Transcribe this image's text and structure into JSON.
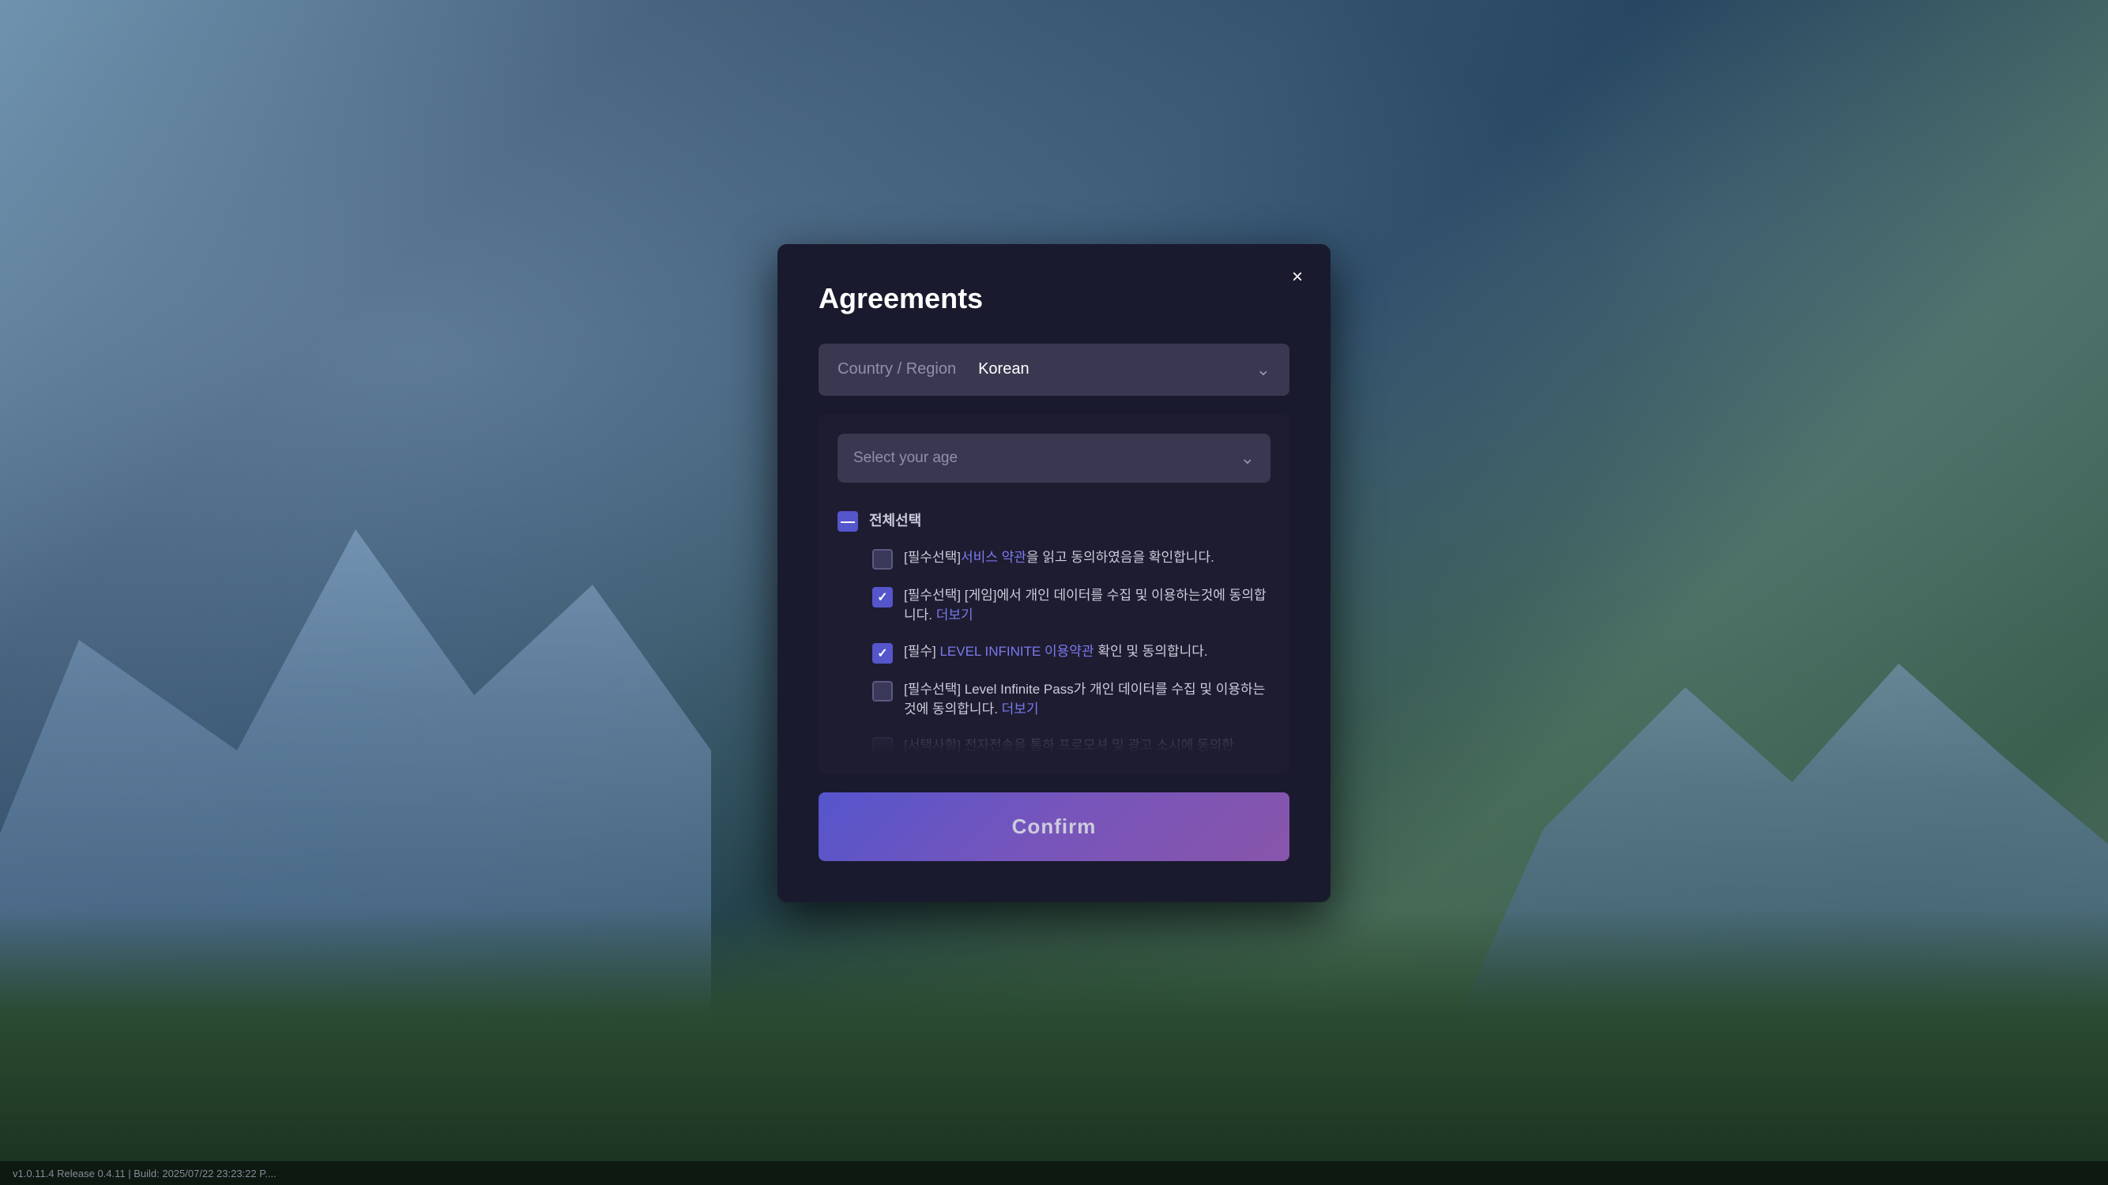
{
  "background": {
    "description": "Mountain landscape with forest"
  },
  "dialog": {
    "title": "Agreements",
    "close_label": "×",
    "country_region_label": "Country / Region",
    "country_region_value": "Korean",
    "age_placeholder": "Select your age",
    "select_all_label": "전체선택",
    "agreements": [
      {
        "id": "item1",
        "state": "unchecked",
        "text_before": "[필수선택]",
        "link_text": "서비스 약관",
        "text_after": "을 읽고 동의하였음을 확인합니다."
      },
      {
        "id": "item2",
        "state": "checked",
        "text": "[필수선택] [게임]에서 개인 데이터를 수집 및 이용하는것에 동의합니다.",
        "link_text": "더보기"
      },
      {
        "id": "item3",
        "state": "checked",
        "text_before": "[필수] ",
        "link_text": "LEVEL INFINITE 이용약관",
        "text_after": " 확인 및 동의합니다."
      },
      {
        "id": "item4",
        "state": "unchecked",
        "text": "[필수선택] Level Infinite Pass가 개인 데이터를 수집 및 이용하는 것에 동의합니다.",
        "link_text": "더보기"
      },
      {
        "id": "item5",
        "state": "unchecked",
        "text": "[서택사항] 전자전송을 통하 프로모셔 및 광고 소시에 동의한"
      }
    ],
    "confirm_label": "Confirm"
  },
  "status_bar": {
    "text": "v1.0.11.4 Release 0.4.11 | Build: 2025/07/22 23:23:22 P...."
  }
}
